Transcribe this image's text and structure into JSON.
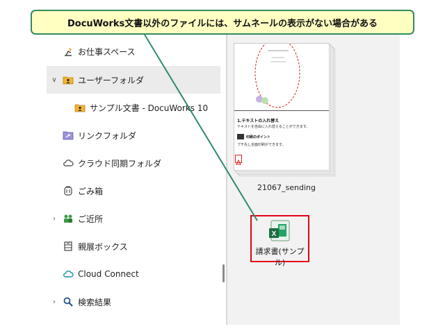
{
  "callout": {
    "text": "DocuWorks文書以外のファイルには、サムネールの表示がない場合がある"
  },
  "sidebar": {
    "items": [
      {
        "label": "お仕事スペース",
        "icon": "desk-lamp-icon",
        "chevron": "",
        "selected": false
      },
      {
        "label": "ユーザーフォルダ",
        "icon": "user-folder-icon",
        "chevron": "∨",
        "selected": true
      },
      {
        "label": "サンプル文書 - DocuWorks 10",
        "icon": "user-folder-icon",
        "chevron": "",
        "selected": false
      },
      {
        "label": "リンクフォルダ",
        "icon": "link-folder-icon",
        "chevron": "",
        "selected": false
      },
      {
        "label": "クラウド同期フォルダ",
        "icon": "cloud-icon",
        "chevron": "",
        "selected": false
      },
      {
        "label": "ごみ箱",
        "icon": "trash-icon",
        "chevron": "",
        "selected": false
      },
      {
        "label": "ご近所",
        "icon": "people-icon",
        "chevron": "›",
        "selected": false
      },
      {
        "label": "親展ボックス",
        "icon": "mailbox-icon",
        "chevron": "",
        "selected": false
      },
      {
        "label": "Cloud Connect",
        "icon": "cloud-connect-icon",
        "chevron": "",
        "selected": false
      },
      {
        "label": "検索結果",
        "icon": "search-icon",
        "chevron": "›",
        "selected": false
      }
    ]
  },
  "content": {
    "files": [
      {
        "name": "21067_sending",
        "type": "docuworks",
        "thumbnail": {
          "heading": "1.テキストの入れ替え",
          "body": "テキストを自由に入れ替えることができます。",
          "subheading": "印刷のポイント",
          "subbody": "プチ先し全面印刷ができます。"
        }
      },
      {
        "name": "請求書(サンプル)",
        "type": "excel",
        "icon_letter": "X"
      }
    ]
  },
  "colors": {
    "callout_border": "#2f8a62",
    "callout_fill": "#ffffc2",
    "highlight_box": "#e60012",
    "pointer_line": "#2f8a62",
    "excel_green": "#1d6f42"
  }
}
